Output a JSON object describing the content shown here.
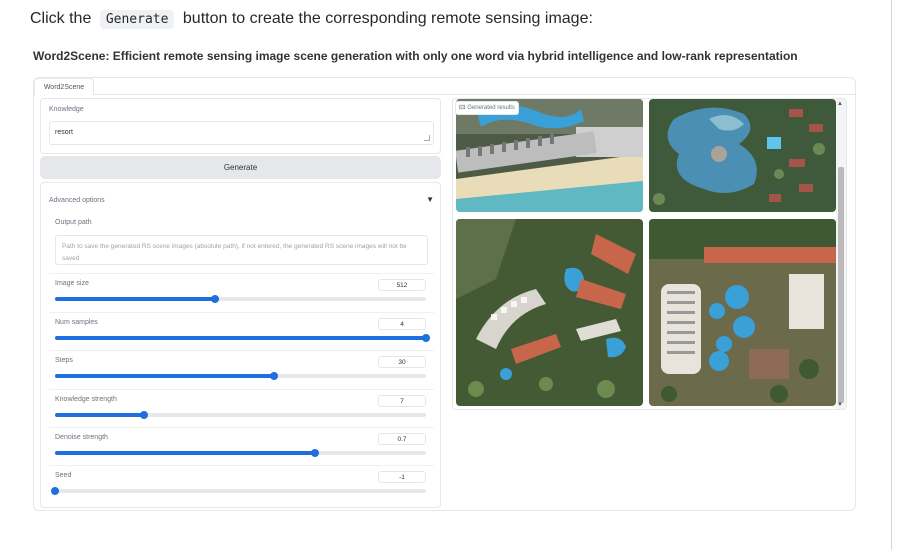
{
  "instruction": {
    "pre": "Click the",
    "code": "Generate",
    "post": "button to create the corresponding remote sensing image:"
  },
  "subtitle": "Word2Scene: Efficient remote sensing image scene generation with only one word via hybrid intelligence and low-rank representation",
  "tab": "Word2Scene",
  "knowledge": {
    "label": "Knowledge",
    "value": "resort"
  },
  "generate_label": "Generate",
  "advanced": {
    "label": "Advanced options",
    "toggle": "▼"
  },
  "output_path": {
    "label": "Output path",
    "placeholder": "Path to save the generated RS scene images (absolute path), if not entered, the generated RS scene images will not be saved"
  },
  "sliders": [
    {
      "label": "Image size",
      "value": "512",
      "fraction": 0.43
    },
    {
      "label": "Num samples",
      "value": "4",
      "fraction": 1.0
    },
    {
      "label": "Steps",
      "value": "30",
      "fraction": 0.59
    },
    {
      "label": "Knowledge strength",
      "value": "7",
      "fraction": 0.24
    },
    {
      "label": "Denoise strength",
      "value": "0.7",
      "fraction": 0.7
    },
    {
      "label": "Seed",
      "value": "-1",
      "fraction": 0.0
    }
  ],
  "gallery": {
    "label": "Generated results"
  },
  "colors": {
    "accent": "#1f6fde",
    "pool": "#3aa0d8",
    "vegetation": "#3f5a33",
    "roof": "#c8664c",
    "sand": "#e9dcb8",
    "sea": "#5fb8c2"
  }
}
